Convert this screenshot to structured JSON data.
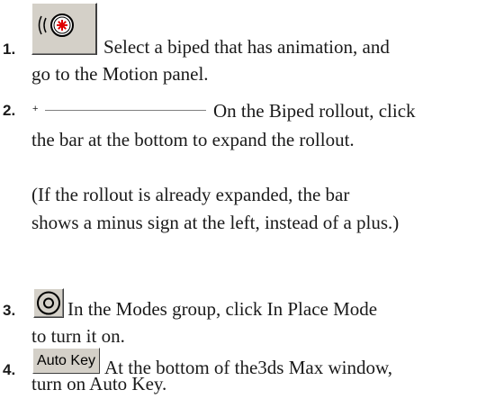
{
  "steps": [
    {
      "number": "1.",
      "icon": "motion-panel-icon",
      "lines": [
        "Select a biped that has animation, and",
        "go to the Motion panel."
      ]
    },
    {
      "number": "2.",
      "icon": "rollout-bar-plus-icon",
      "plus_glyph": "+",
      "lines": [
        "On the Biped rollout, click",
        "the bar at the bottom to expand the rollout."
      ]
    },
    {
      "note_lines": [
        "(If the rollout is already expanded, the bar",
        "shows a minus sign at the left, instead of a plus.)"
      ]
    },
    {
      "number": "3.",
      "icon": "in-place-mode-icon",
      "lines": [
        "In the Modes group, click In Place Mode",
        "to turn it on."
      ]
    },
    {
      "number": "4.",
      "button_label": "Auto Key",
      "lines": [
        "At the bottom of the3ds Max window,",
        "turn on Auto Key."
      ]
    }
  ],
  "colors": {
    "button_face": "#d4d0c8",
    "text": "#1a1a1a",
    "icon_red": "#e00000"
  }
}
